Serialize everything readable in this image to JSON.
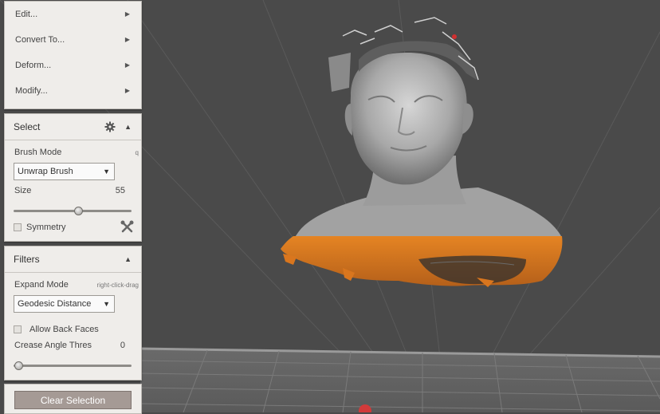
{
  "menu": {
    "items": [
      {
        "label": "Edit..."
      },
      {
        "label": "Convert To..."
      },
      {
        "label": "Deform..."
      },
      {
        "label": "Modify..."
      }
    ],
    "arrow_glyph": "▶"
  },
  "select_panel": {
    "title": "Select",
    "brush_mode_label": "Brush Mode",
    "brush_mode_hint": "q",
    "brush_mode_value": "Unwrap Brush",
    "size_label": "Size",
    "size_value": "55",
    "size_fraction": 0.55,
    "symmetry_label": "Symmetry",
    "symmetry_checked": false
  },
  "filters_panel": {
    "title": "Filters",
    "expand_mode_label": "Expand Mode",
    "expand_mode_hint": "right-click-drag",
    "expand_mode_value": "Geodesic Distance",
    "allow_back_faces_label": "Allow Back Faces",
    "allow_back_faces_checked": false,
    "crease_angle_label": "Crease Angle Thres",
    "crease_angle_value": "0",
    "crease_angle_fraction": 0.0
  },
  "actions": {
    "clear_selection_label": "Clear Selection"
  },
  "glyphs": {
    "collapse": "▲",
    "dropdown": "▼"
  },
  "colors": {
    "viewport_bg": "#4a4a4a",
    "mesh_gray": "#a9a9a9",
    "selection_orange": "#d9761e",
    "panel_bg": "#efedea",
    "button_bg": "#a59a95"
  },
  "icons": [
    "gear-icon",
    "wrench-icon",
    "collapse-icon",
    "menu-arrow-icon",
    "dropdown-caret-icon"
  ]
}
